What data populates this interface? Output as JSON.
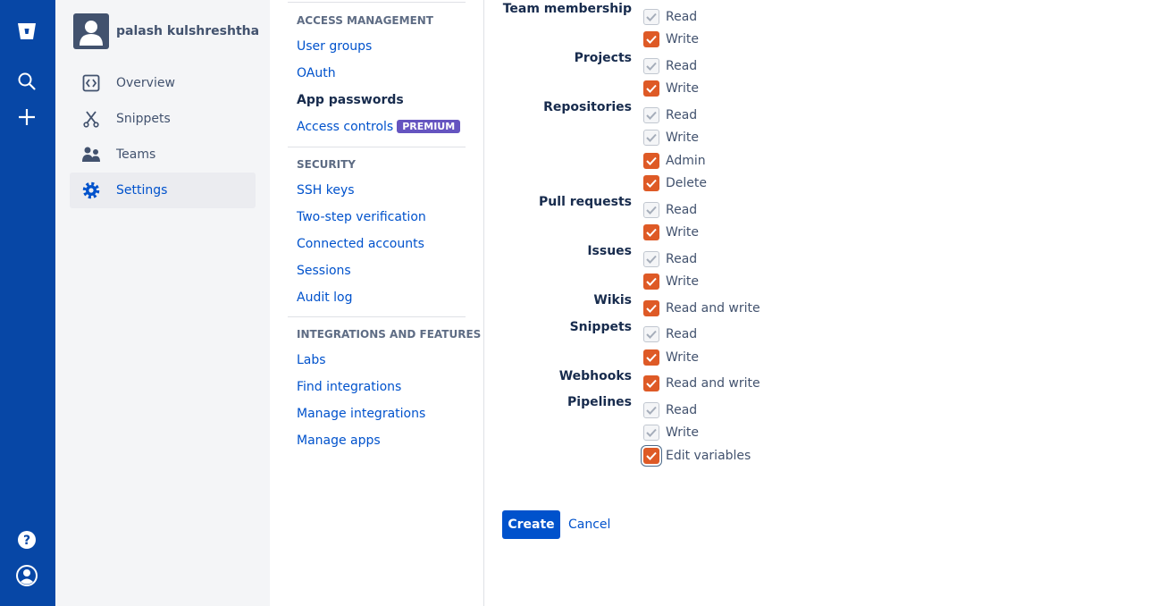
{
  "global_nav": {
    "icons": [
      "bitbucket-logo-icon",
      "search-icon",
      "create-icon",
      "help-icon",
      "profile-icon"
    ],
    "color": "#0747a6"
  },
  "profile": {
    "name": "palash kulshreshtha"
  },
  "container_nav": {
    "items": [
      {
        "label": "Overview",
        "icon": "overview-icon"
      },
      {
        "label": "Snippets",
        "icon": "snippets-icon"
      },
      {
        "label": "Teams",
        "icon": "teams-icon"
      },
      {
        "label": "Settings",
        "icon": "gear-icon",
        "active": true
      }
    ]
  },
  "settings_nav": {
    "access_management": {
      "heading": "ACCESS MANAGEMENT",
      "items": [
        "User groups",
        "OAuth",
        "App passwords",
        "Access controls"
      ],
      "premium_badge": "PREMIUM",
      "current": "App passwords"
    },
    "security": {
      "heading": "SECURITY",
      "items": [
        "SSH keys",
        "Two-step verification",
        "Connected accounts",
        "Sessions",
        "Audit log"
      ]
    },
    "integrations": {
      "heading": "INTEGRATIONS AND FEATURES",
      "items": [
        "Labs",
        "Find integrations",
        "Manage integrations",
        "Manage apps"
      ]
    }
  },
  "permissions": {
    "groups": [
      {
        "label": "Team membership",
        "options": [
          {
            "label": "Read",
            "checked": true,
            "disabled": true
          },
          {
            "label": "Write",
            "checked": true,
            "disabled": false
          }
        ]
      },
      {
        "label": "Projects",
        "options": [
          {
            "label": "Read",
            "checked": true,
            "disabled": true
          },
          {
            "label": "Write",
            "checked": true,
            "disabled": false
          }
        ]
      },
      {
        "label": "Repositories",
        "options": [
          {
            "label": "Read",
            "checked": true,
            "disabled": true
          },
          {
            "label": "Write",
            "checked": true,
            "disabled": true
          },
          {
            "label": "Admin",
            "checked": true,
            "disabled": false
          },
          {
            "label": "Delete",
            "checked": true,
            "disabled": false
          }
        ]
      },
      {
        "label": "Pull requests",
        "options": [
          {
            "label": "Read",
            "checked": true,
            "disabled": true
          },
          {
            "label": "Write",
            "checked": true,
            "disabled": false
          }
        ]
      },
      {
        "label": "Issues",
        "options": [
          {
            "label": "Read",
            "checked": true,
            "disabled": true
          },
          {
            "label": "Write",
            "checked": true,
            "disabled": false
          }
        ]
      },
      {
        "label": "Wikis",
        "options": [
          {
            "label": "Read and write",
            "checked": true,
            "disabled": false
          }
        ]
      },
      {
        "label": "Snippets",
        "options": [
          {
            "label": "Read",
            "checked": true,
            "disabled": true
          },
          {
            "label": "Write",
            "checked": true,
            "disabled": false
          }
        ]
      },
      {
        "label": "Webhooks",
        "options": [
          {
            "label": "Read and write",
            "checked": true,
            "disabled": false
          }
        ]
      },
      {
        "label": "Pipelines",
        "options": [
          {
            "label": "Read",
            "checked": true,
            "disabled": true
          },
          {
            "label": "Write",
            "checked": true,
            "disabled": true
          },
          {
            "label": "Edit variables",
            "checked": true,
            "disabled": false,
            "focused": true
          }
        ]
      }
    ]
  },
  "actions": {
    "create": "Create",
    "cancel": "Cancel"
  },
  "colors": {
    "accent": "#0052cc",
    "checkbox_checked": "#de5a26",
    "sidebar_bg": "#f4f5f7"
  }
}
